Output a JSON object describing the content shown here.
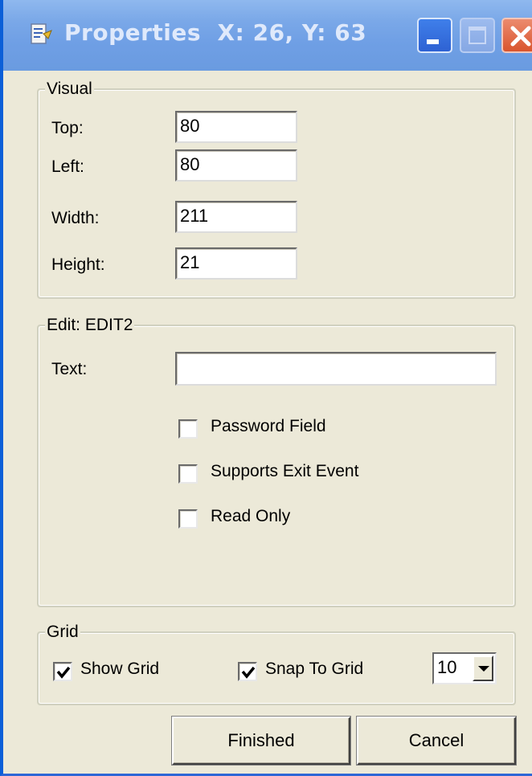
{
  "window": {
    "title": "Properties",
    "coords": "X: 26, Y: 63"
  },
  "visual": {
    "legend": "Visual",
    "top_label": "Top:",
    "top_value": "80",
    "left_label": "Left:",
    "left_value": "80",
    "width_label": "Width:",
    "width_value": "211",
    "height_label": "Height:",
    "height_value": "21"
  },
  "edit": {
    "legend": "Edit: EDIT2",
    "text_label": "Text:",
    "text_value": "",
    "password_label": "Password Field",
    "password_checked": false,
    "exit_event_label": "Supports Exit Event",
    "exit_event_checked": false,
    "read_only_label": "Read Only",
    "read_only_checked": false
  },
  "grid": {
    "legend": "Grid",
    "show_grid_label": "Show Grid",
    "show_grid_checked": true,
    "snap_label": "Snap To Grid",
    "snap_checked": true,
    "size_value": "10"
  },
  "buttons": {
    "finished": "Finished",
    "cancel": "Cancel"
  },
  "icons": {
    "app": "properties-app-icon",
    "minimize": "minimize-icon",
    "maximize": "maximize-icon",
    "close": "close-icon",
    "checkmark": "checkmark-icon",
    "dropdown": "chevron-down-icon"
  },
  "colors": {
    "titlebar": "#7aa8e8",
    "dialog_bg": "#ece9d8",
    "close_button": "#d9552e"
  }
}
